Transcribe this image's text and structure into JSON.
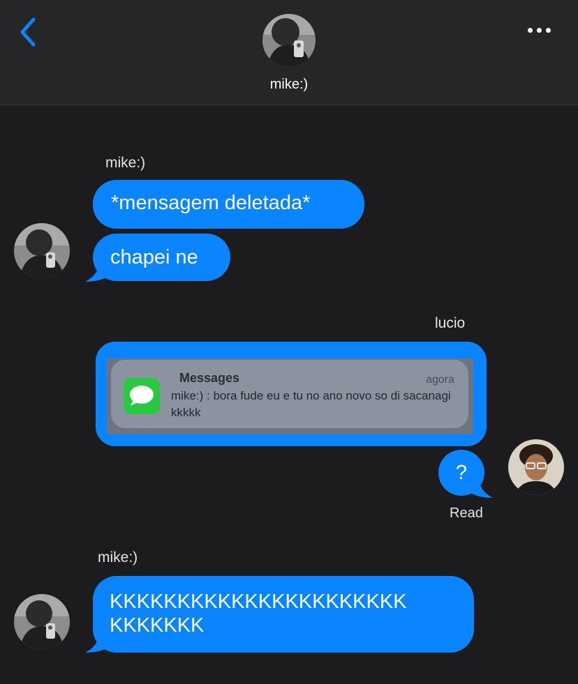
{
  "header": {
    "title": "mike:)",
    "back_icon": "chevron-left-icon",
    "more_icon": "ellipsis-icon"
  },
  "messages": [
    {
      "sender": "mike:)",
      "texts": [
        "*mensagem deletada*",
        "chapei ne"
      ]
    },
    {
      "sender": "lucio",
      "attachment": {
        "app": "Messages",
        "time": "agora",
        "body": "mike:) : bora fude eu e tu no ano novo so di sacanagi kkkkk"
      },
      "text": "?",
      "status": "Read"
    },
    {
      "sender": "mike:)",
      "texts": [
        "KKKKKKKKKKKKKKKKKKKKKK KKKKKKK"
      ]
    }
  ],
  "colors": {
    "background": "#1c1c1e",
    "header": "#262628",
    "bubble": "#0a84ff",
    "accent": "#0a84ff"
  }
}
